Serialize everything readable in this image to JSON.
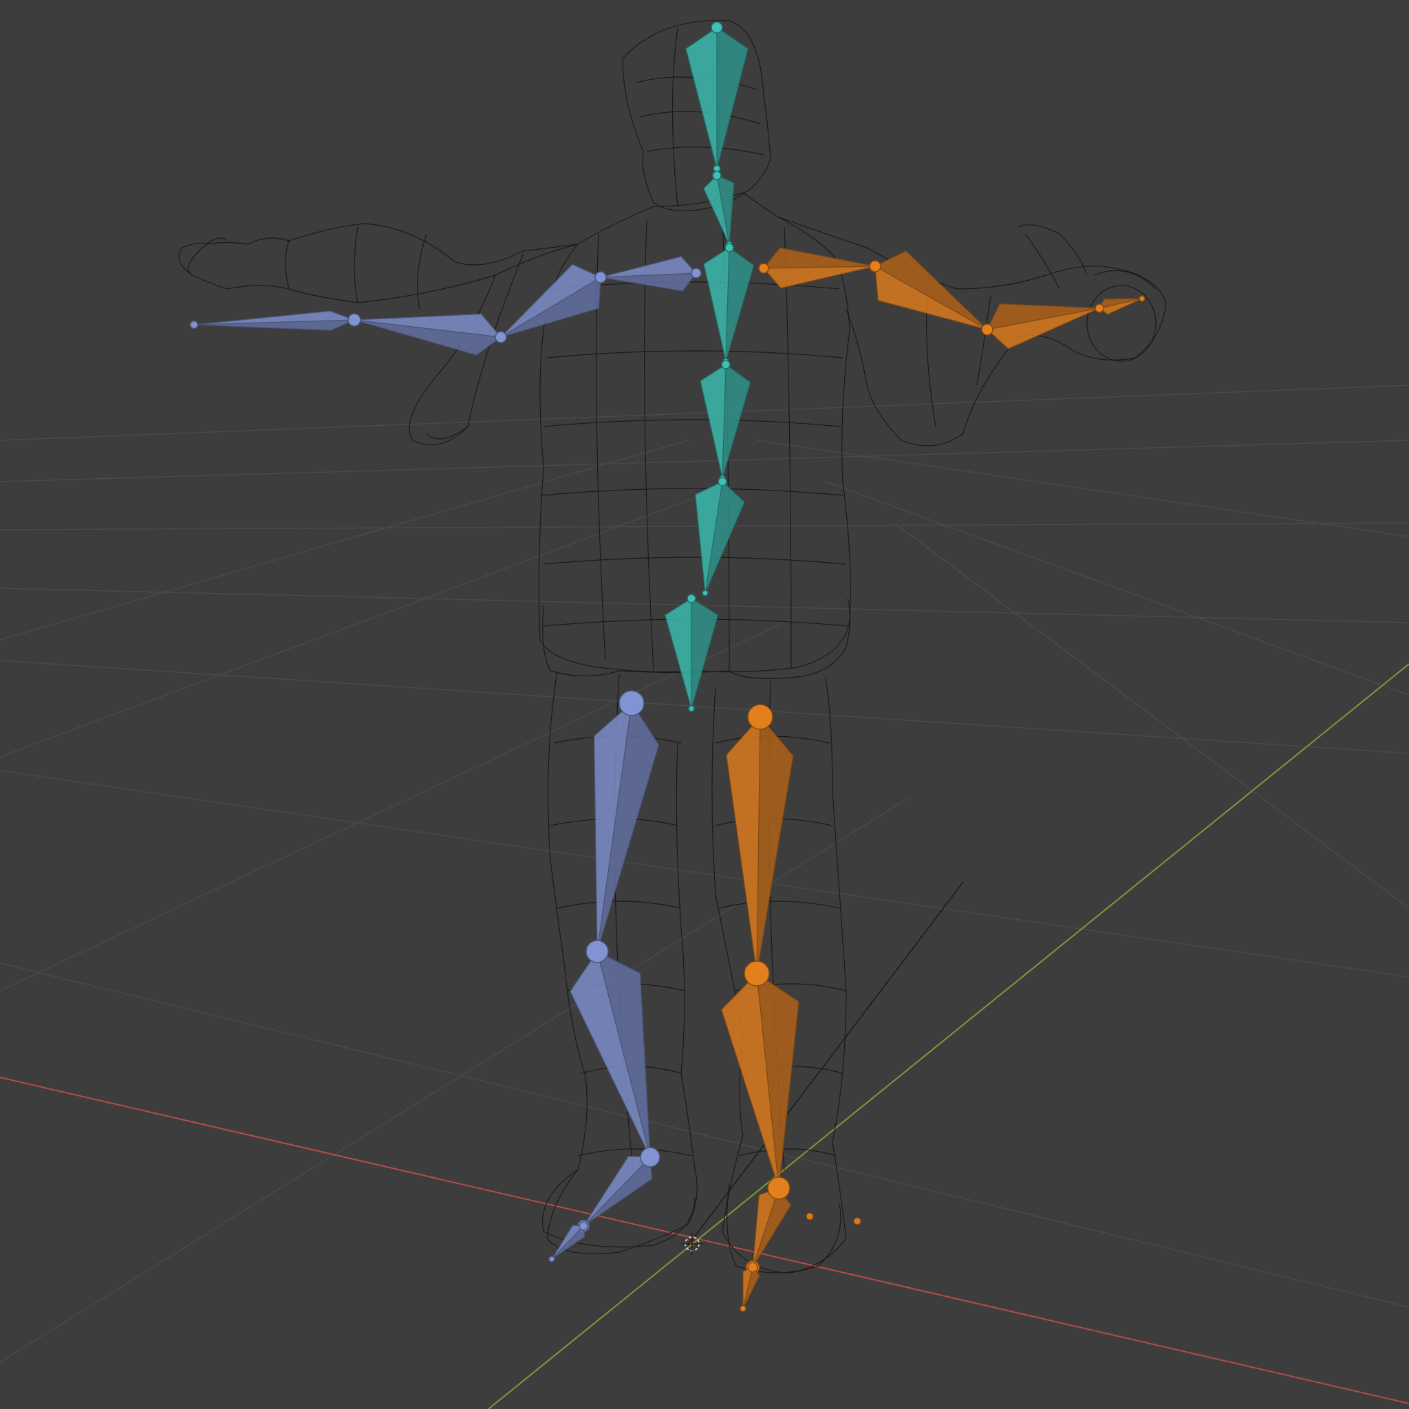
{
  "viewport": {
    "mode": "wireframe",
    "background_color": "#3d3d3d",
    "grid_color": "#4a4a4a",
    "x_axis_color": "#b84b4b",
    "y_axis_color": "#7e9a3a",
    "wireframe_color": "#1a1a1a"
  },
  "armature": {
    "spine_color": "#3ab8ad",
    "left_side_color": "#7b8cc8",
    "right_side_color": "#d9791d",
    "bones": [
      {
        "name": "head",
        "group": "spine"
      },
      {
        "name": "neck",
        "group": "spine"
      },
      {
        "name": "spine-upper",
        "group": "spine"
      },
      {
        "name": "spine-mid",
        "group": "spine"
      },
      {
        "name": "spine-lower",
        "group": "spine"
      },
      {
        "name": "hips",
        "group": "spine"
      },
      {
        "name": "shoulder-left",
        "group": "left"
      },
      {
        "name": "upper-arm-left",
        "group": "left"
      },
      {
        "name": "forearm-left",
        "group": "left"
      },
      {
        "name": "hand-left",
        "group": "left"
      },
      {
        "name": "thigh-left",
        "group": "left"
      },
      {
        "name": "shin-left",
        "group": "left"
      },
      {
        "name": "foot-left",
        "group": "left"
      },
      {
        "name": "toe-left",
        "group": "left"
      },
      {
        "name": "shoulder-right",
        "group": "right"
      },
      {
        "name": "upper-arm-right",
        "group": "right"
      },
      {
        "name": "forearm-right",
        "group": "right"
      },
      {
        "name": "hand-right",
        "group": "right"
      },
      {
        "name": "thigh-right",
        "group": "right"
      },
      {
        "name": "shin-right",
        "group": "right"
      },
      {
        "name": "foot-right",
        "group": "right"
      },
      {
        "name": "toe-right",
        "group": "right"
      }
    ]
  },
  "objects": {
    "mesh": "character-mesh",
    "cursor": "3d-cursor-icon"
  }
}
